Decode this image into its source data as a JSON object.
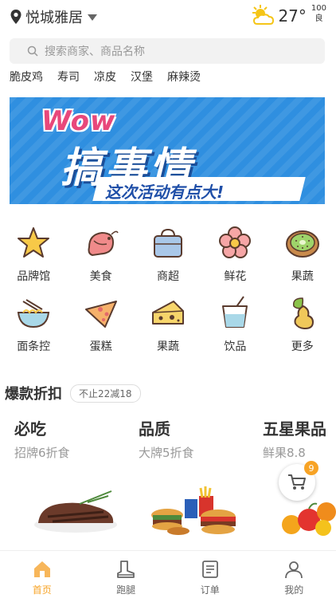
{
  "colors": {
    "accent": "#f7a325",
    "banner_bg": "#2f8fe0",
    "wow": "#e8487b"
  },
  "header": {
    "location": "悦城雅居",
    "temperature": "27°",
    "aqi_value": "100",
    "aqi_label": "良"
  },
  "search": {
    "placeholder": "搜索商家、商品名称"
  },
  "hot_words": [
    "脆皮鸡",
    "寿司",
    "凉皮",
    "汉堡",
    "麻辣烫"
  ],
  "banner": {
    "wow": "Wow",
    "headline": "搞事情",
    "tagline": "这次活动有点大!"
  },
  "categories": [
    {
      "label": "品牌馆",
      "icon": "star-icon"
    },
    {
      "label": "美食",
      "icon": "shrimp-icon"
    },
    {
      "label": "商超",
      "icon": "shopping-bag-icon"
    },
    {
      "label": "鲜花",
      "icon": "flower-icon"
    },
    {
      "label": "果蔬",
      "icon": "kiwi-icon"
    },
    {
      "label": "面条控",
      "icon": "noodle-bowl-icon"
    },
    {
      "label": "蛋糕",
      "icon": "pizza-slice-icon"
    },
    {
      "label": "果蔬",
      "icon": "cheese-icon"
    },
    {
      "label": "饮品",
      "icon": "drink-cup-icon"
    },
    {
      "label": "更多",
      "icon": "pear-icon"
    }
  ],
  "flash_sale": {
    "title": "爆款折扣",
    "pill": "不止22减18",
    "deals": [
      {
        "title": "必吃",
        "subtitle": "招牌6折食"
      },
      {
        "title": "品质",
        "subtitle": "大牌5折食"
      },
      {
        "title": "五星果品",
        "subtitle": "鲜果8.8"
      }
    ]
  },
  "cart": {
    "count": "9"
  },
  "tabs": [
    {
      "label": "首页",
      "icon": "home-icon",
      "active": true
    },
    {
      "label": "跑腿",
      "icon": "boot-icon",
      "active": false
    },
    {
      "label": "订单",
      "icon": "order-list-icon",
      "active": false
    },
    {
      "label": "我的",
      "icon": "profile-icon",
      "active": false
    }
  ]
}
